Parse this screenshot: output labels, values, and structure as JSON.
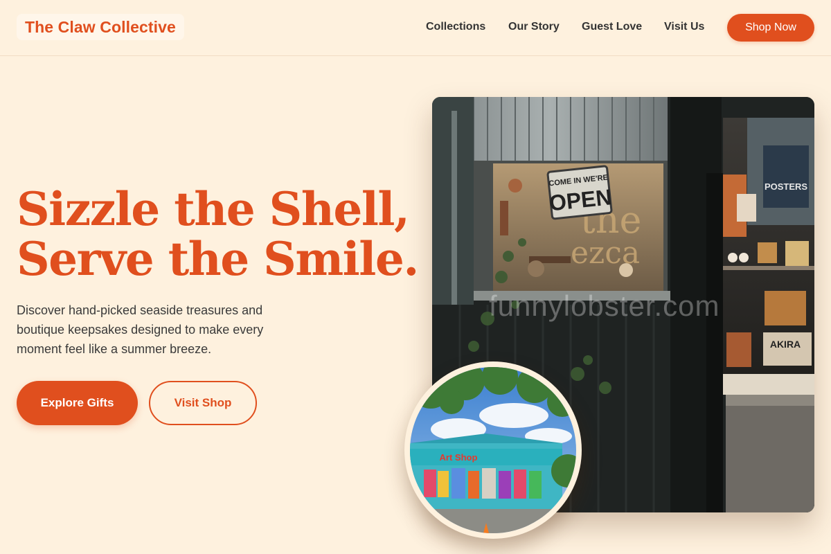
{
  "header": {
    "brand": "The Claw Collective",
    "nav": [
      "Collections",
      "Our Story",
      "Guest Love",
      "Visit Us"
    ],
    "cta": "Shop Now"
  },
  "hero": {
    "title_line1": "Sizzle the Shell,",
    "title_line2": "Serve the Smile.",
    "subtitle": "Discover hand-picked seaside treasures and boutique keepsakes designed to make every moment feel like a summer breeze.",
    "primary_button": "Explore Gifts",
    "secondary_button": "Visit Shop"
  },
  "images": {
    "main": {
      "sign_line1": "COME IN WE'RE",
      "sign_line2": "OPEN",
      "poster_text": "POSTERS",
      "book_text": "AKIRA",
      "watermark": "funnylobster.com"
    },
    "inset": {
      "shop_sign": "Art Shop"
    }
  },
  "colors": {
    "accent": "#e04f1e",
    "background": "#fef1de",
    "text": "#333333"
  }
}
